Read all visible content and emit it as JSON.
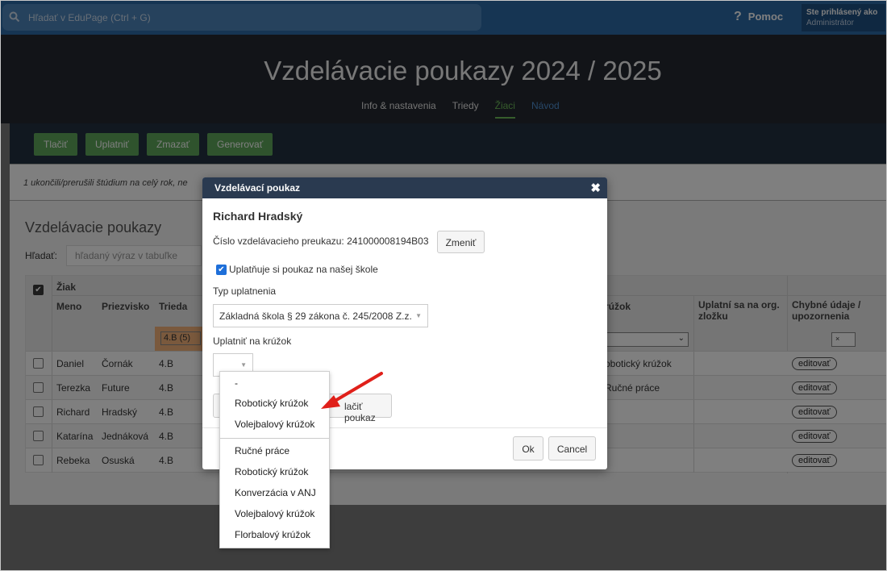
{
  "topbar": {
    "search_placeholder": "Hľadať v EduPage (Ctrl + G)",
    "help_label": "Pomoc",
    "user_line1": "Ste prihlásený ako",
    "user_line2": "Administrátor"
  },
  "header": {
    "title": "Vzdelávacie poukazy 2024 / 2025",
    "nav": [
      "Info & nastavenia",
      "Triedy",
      "Žiaci",
      "Návod"
    ]
  },
  "toolbar": {
    "buttons": [
      "Tlačiť",
      "Uplatniť",
      "Zmazať",
      "Generovať"
    ]
  },
  "notice": "1 ukončili/prerušili štúdium na celý rok, ne",
  "section": {
    "title": "Vzdelávacie poukazy",
    "search_label": "Hľadať:",
    "search_placeholder": "hľadaný výraz v tabuľke"
  },
  "table": {
    "group_header": "Žiak",
    "columns": [
      "Meno",
      "Priezvisko",
      "Trieda"
    ],
    "right_col_krouzok": "rúžok",
    "right_col_org": "Uplatní sa na org. zložku",
    "right_col_errors": "Chybné údaje / upozornenia",
    "class_filter": "4.B (5)",
    "error_filter": "×",
    "edit_label": "editovať",
    "rows": [
      {
        "meno": "Daniel",
        "priezvisko": "Čornák",
        "trieda": "4.B",
        "krouzok": "obotický krúžok"
      },
      {
        "meno": "Terezka",
        "priezvisko": "Future",
        "trieda": "4.B",
        "krouzok": "Ručné práce"
      },
      {
        "meno": "Richard",
        "priezvisko": "Hradský",
        "trieda": "4.B",
        "krouzok": ""
      },
      {
        "meno": "Katarína",
        "priezvisko": "Jednáková",
        "trieda": "4.B",
        "krouzok": ""
      },
      {
        "meno": "Rebeka",
        "priezvisko": "Osuská",
        "trieda": "4.B",
        "krouzok": ""
      }
    ]
  },
  "modal": {
    "title": "Vzdelávací poukaz",
    "close": "✖",
    "student": "Richard Hradský",
    "card_label": "Číslo vzdelávacieho preukazu: 241000008194B03",
    "change_button": "Zmeniť",
    "uses_label": "Uplatňuje si poukaz na našej škole",
    "type_label": "Typ uplatnenia",
    "type_value": "Základná škola § 29 zákona č. 245/2008 Z.z.",
    "club_label": "Uplatniť na krúžok",
    "print_button": "lačiť poukaz",
    "ok_button": "Ok",
    "cancel_button": "Cancel"
  },
  "dropdown": {
    "options_top": [
      "-",
      "Robotický krúžok",
      "Volejbalový krúžok"
    ],
    "options_bottom": [
      "Ručné práce",
      "Robotický krúžok",
      "Konverzácia v ANJ",
      "Volejbalový krúžok",
      "Florbalový krúžok"
    ]
  },
  "colors": {
    "accent_green": "#5fa75b",
    "header_blue": "#2d6aa6",
    "annotation_red": "#e0201a"
  }
}
